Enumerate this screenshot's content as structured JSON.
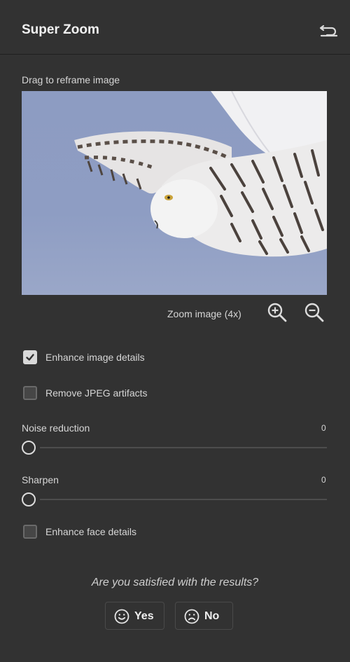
{
  "header": {
    "title": "Super Zoom",
    "reset_icon": "undo-icon"
  },
  "preview": {
    "label": "Drag to reframe image"
  },
  "zoom": {
    "label": "Zoom image (4x)",
    "zoom_in_icon": "zoom-in-icon",
    "zoom_out_icon": "zoom-out-icon"
  },
  "options": {
    "enhance_details": {
      "label": "Enhance image details",
      "checked": true
    },
    "remove_jpeg": {
      "label": "Remove JPEG artifacts",
      "checked": false
    },
    "enhance_face": {
      "label": "Enhance face details",
      "checked": false
    }
  },
  "sliders": {
    "noise": {
      "label": "Noise reduction",
      "value": "0"
    },
    "sharpen": {
      "label": "Sharpen",
      "value": "0"
    }
  },
  "feedback": {
    "question": "Are you satisfied with the results?",
    "yes_label": "Yes",
    "no_label": "No"
  },
  "colors": {
    "panel_bg": "#323232",
    "text": "#d6d6d6",
    "sky": "#8e9dc3"
  }
}
